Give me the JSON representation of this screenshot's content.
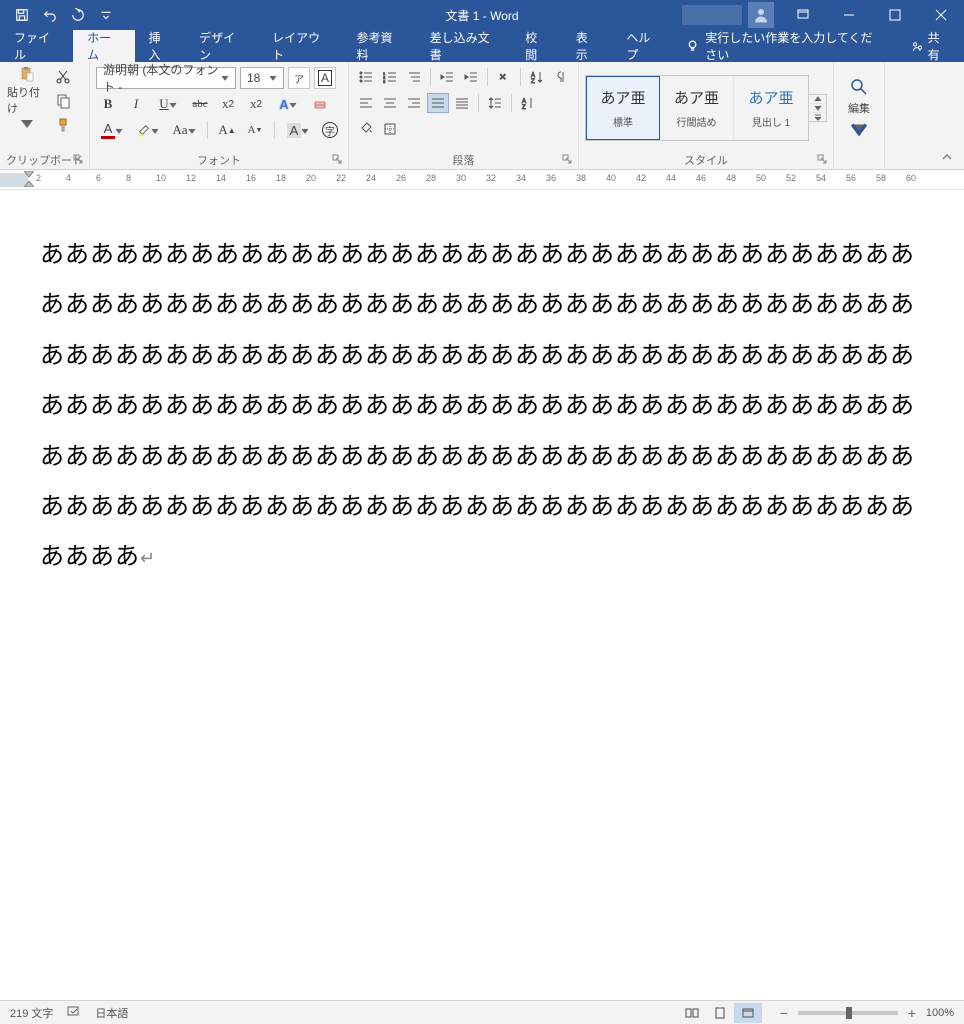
{
  "titlebar": {
    "title": "文書 1  -  Word"
  },
  "tabs": {
    "file": "ファイル",
    "home": "ホーム",
    "insert": "挿入",
    "design": "デザイン",
    "layout": "レイアウト",
    "references": "参考資料",
    "mailings": "差し込み文書",
    "review": "校閲",
    "view": "表示",
    "help": "ヘルプ",
    "tell_me": "実行したい作業を入力してください",
    "share": "共有"
  },
  "ribbon": {
    "clipboard": {
      "label": "クリップボード",
      "paste": "貼り付け"
    },
    "font": {
      "label": "フォント",
      "name": "游明朝 (本文のフォント -",
      "size": "18"
    },
    "paragraph": {
      "label": "段落"
    },
    "styles": {
      "label": "スタイル",
      "preview": "あア亜",
      "items": [
        "標準",
        "行間詰め",
        "見出し 1"
      ]
    },
    "edit": {
      "label": "編集"
    }
  },
  "ruler": {
    "numbers": [
      2,
      4,
      6,
      8,
      10,
      12,
      14,
      16,
      18,
      20,
      22,
      24,
      26,
      28,
      30,
      32,
      34,
      36,
      38,
      40,
      42,
      44,
      46,
      48,
      50,
      52,
      54,
      56,
      58,
      60
    ]
  },
  "document": {
    "text": "ああああああああああああああああああああああああああああああああああああああああああああああああああああああああああああああああああああああああああああああああああああああああああああああああああああああああああああああああああああああああああああああああああああああああああああああああああああああああああああああああああああああああああああああああああああああああああああああああああああああああああああああああああああああ"
  },
  "status": {
    "chars": "219 文字",
    "lang": "日本語",
    "zoom": "100%"
  }
}
